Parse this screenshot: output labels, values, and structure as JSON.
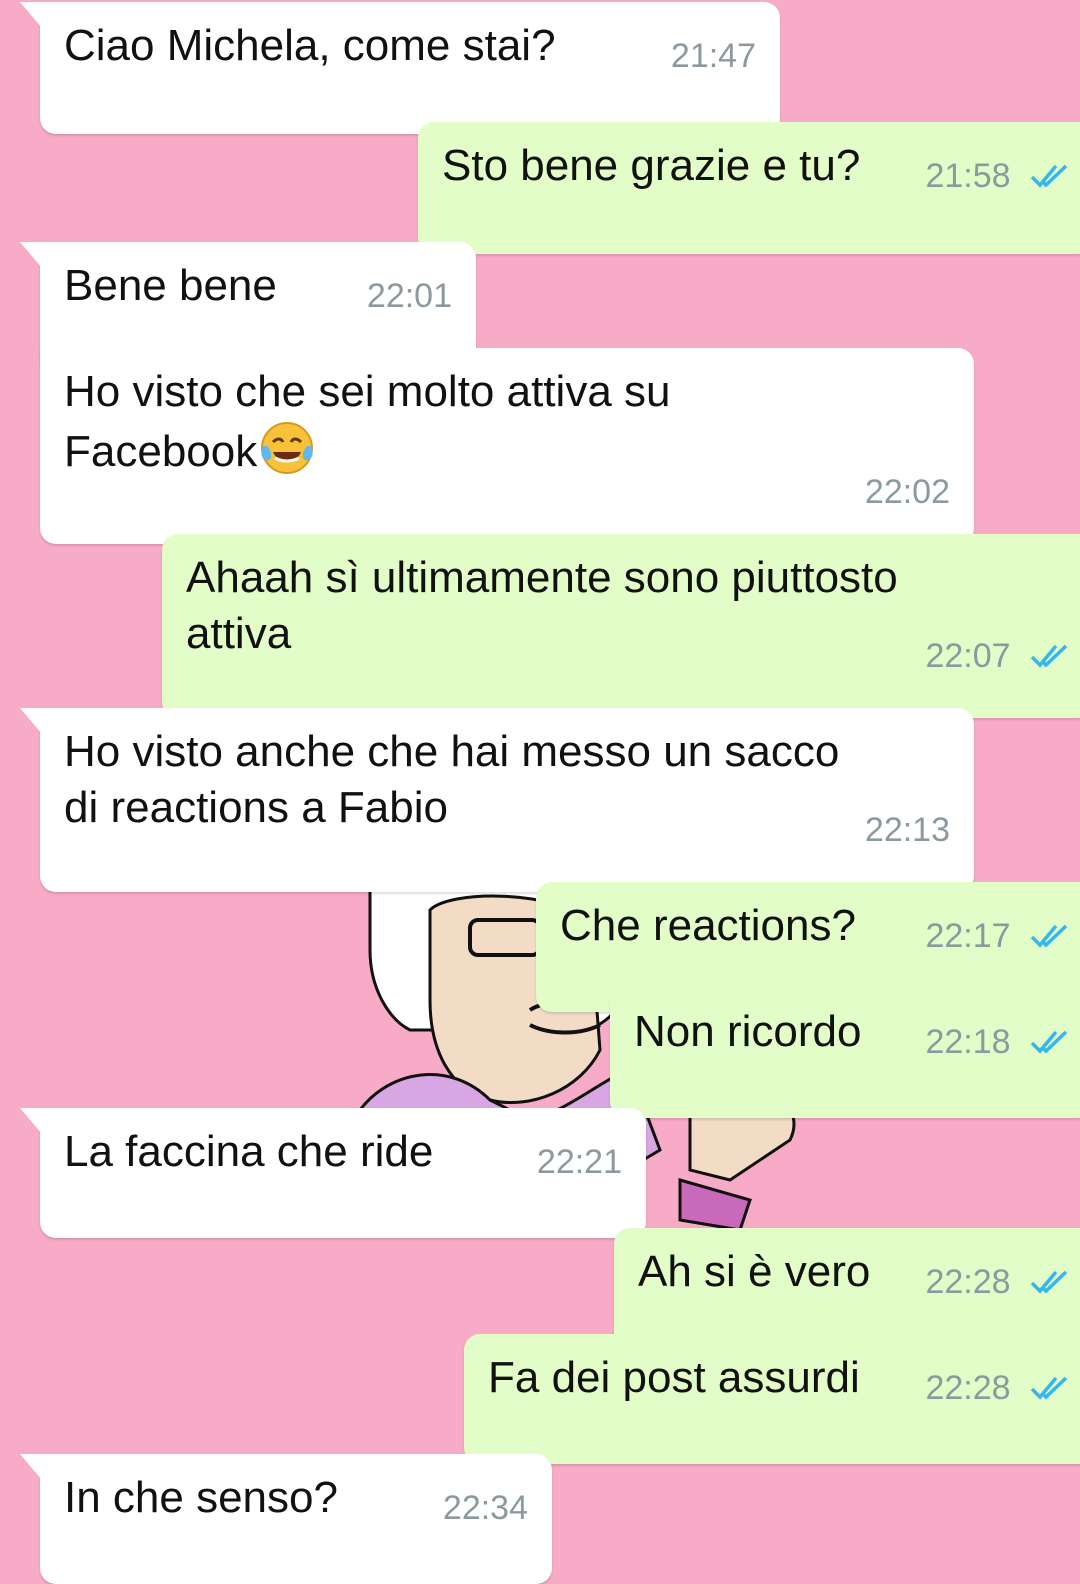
{
  "chat": {
    "messages": [
      {
        "direction": "in",
        "text": "Ciao Michela, come stai?",
        "time": "21:47"
      },
      {
        "direction": "out",
        "text": "Sto bene grazie e tu?",
        "time": "21:58",
        "status": "read"
      },
      {
        "direction": "in",
        "text": "Bene bene",
        "time": "22:01"
      },
      {
        "direction": "in",
        "text": "Ho visto che sei molto attiva su Facebook",
        "emoji": "face-with-tears-of-joy",
        "time": "22:02"
      },
      {
        "direction": "out",
        "text": "Ahaah sì ultimamente sono piuttosto attiva",
        "time": "22:07",
        "status": "read"
      },
      {
        "direction": "in",
        "text": "Ho visto anche che hai messo un sacco di reactions a Fabio",
        "time": "22:13"
      },
      {
        "direction": "out",
        "text": "Che reactions?",
        "time": "22:17",
        "status": "read"
      },
      {
        "direction": "out",
        "text": "Non ricordo",
        "time": "22:18",
        "status": "read"
      },
      {
        "direction": "in",
        "text": "La faccina che ride",
        "time": "22:21"
      },
      {
        "direction": "out",
        "text": "Ah si è vero",
        "time": "22:28",
        "status": "read"
      },
      {
        "direction": "out",
        "text": "Fa dei post assurdi",
        "time": "22:28",
        "status": "read"
      },
      {
        "direction": "in",
        "text": "In che senso?",
        "time": "22:34"
      }
    ]
  },
  "colors": {
    "wallpaper": "#f8abc6",
    "incoming_bubble": "#ffffff",
    "outgoing_bubble": "#e2fdc7",
    "timestamp": "#8c9aa0",
    "read_ticks": "#34b7f1"
  },
  "icons": {
    "read_receipt": "double-check-icon",
    "emoji": "face-with-tears-of-joy-emoji"
  }
}
